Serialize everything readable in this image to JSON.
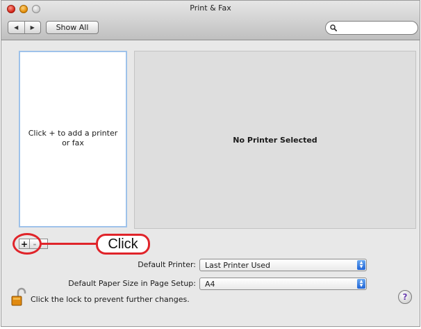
{
  "window": {
    "title": "Print & Fax"
  },
  "toolbar": {
    "back_glyph": "◀",
    "forward_glyph": "▶",
    "show_all_label": "Show All",
    "search": {
      "value": "",
      "placeholder": ""
    }
  },
  "printer_list": {
    "empty_hint": "Click + to add a printer or fax"
  },
  "detail": {
    "message": "No Printer Selected"
  },
  "list_buttons": {
    "add": "+",
    "remove": "-"
  },
  "callout": {
    "text": "Click",
    "color": "#e0242a"
  },
  "settings": {
    "default_printer": {
      "label": "Default Printer:",
      "value": "Last Printer Used"
    },
    "paper_size": {
      "label": "Default Paper Size in Page Setup:",
      "value": "A4"
    }
  },
  "footer": {
    "lock_text": "Click the lock to prevent further changes.",
    "help_glyph": "?"
  },
  "icons": {
    "back": "chevron-left-icon",
    "forward": "chevron-right-icon",
    "search": "magnifier-icon",
    "lock": "open-lock-icon",
    "help": "question-mark-icon",
    "popup": "up-down-arrows-icon"
  },
  "colors": {
    "list_focus_ring": "#9ec2ea",
    "popup_accent": "#1f64d6"
  }
}
